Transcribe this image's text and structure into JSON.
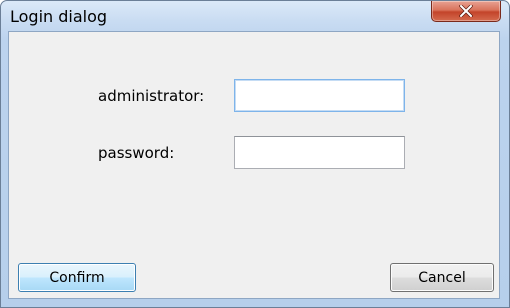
{
  "window": {
    "title": "Login dialog"
  },
  "titlebar": {
    "close_icon": "close-icon"
  },
  "form": {
    "administrator_label": "administrator:",
    "administrator_value": "",
    "password_label": "password:",
    "password_value": ""
  },
  "buttons": {
    "confirm_label": "Confirm",
    "cancel_label": "Cancel"
  },
  "colors": {
    "frame": "#b6cfeb",
    "client": "#f0f0f0",
    "close_button": "#c3442a",
    "focus_border": "#7eb4ea",
    "default_button_border": "#3c7fb1"
  }
}
